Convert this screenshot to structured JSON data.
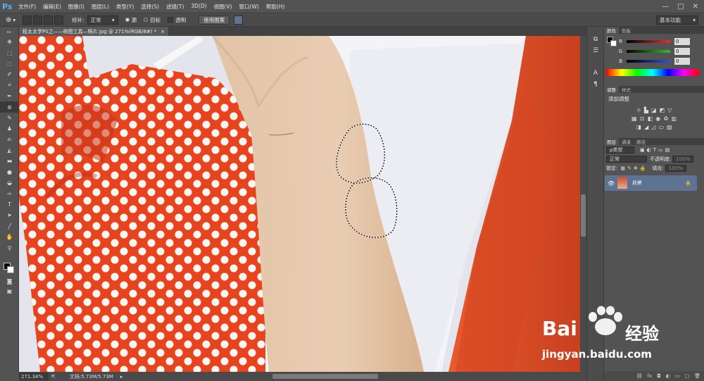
{
  "app": {
    "logo": "Ps"
  },
  "menu": [
    "文件(F)",
    "编辑(E)",
    "图像(I)",
    "图层(L)",
    "类型(Y)",
    "选择(S)",
    "滤镜(T)",
    "3D(D)",
    "视图(V)",
    "窗口(W)",
    "帮助(H)"
  ],
  "window_controls": [
    "—",
    "□",
    "✕"
  ],
  "options": {
    "mode_label": "修补:",
    "mode_value": "正常",
    "source_label": "源",
    "dest_label": "目标",
    "transparent_label": "透明",
    "use_pattern_label": "使用图案",
    "workspace": "基本功能"
  },
  "document": {
    "tab_title": "程太太学PS之——修图工具—照片.jpg @ 271%(RGB/8#) *",
    "close": "×"
  },
  "status": {
    "zoom": "271.34%",
    "doc_info": "文档:5.73M/5.73M"
  },
  "tools": [
    "move-tool",
    "marquee-tool",
    "lasso-tool",
    "quick-select-tool",
    "crop-tool",
    "eyedropper-tool",
    "patch-tool",
    "brush-tool",
    "stamp-tool",
    "history-brush-tool",
    "eraser-tool",
    "gradient-tool",
    "blur-tool",
    "dodge-tool",
    "pen-tool",
    "type-tool",
    "path-select-tool",
    "shape-tool",
    "hand-tool",
    "zoom-tool"
  ],
  "color_panel": {
    "tabs": [
      "颜色",
      "色板"
    ],
    "channels": [
      {
        "label": "R",
        "value": "0",
        "color": "#e53030"
      },
      {
        "label": "G",
        "value": "0",
        "color": "#30c030"
      },
      {
        "label": "B",
        "value": "0",
        "color": "#3050e0"
      }
    ]
  },
  "adjust_panel": {
    "tabs": [
      "调整",
      "样式"
    ],
    "title": "添加调整"
  },
  "layers_panel": {
    "tabs": [
      "图层",
      "通道",
      "路径"
    ],
    "filter_label": "ρ类型",
    "blend_mode": "正常",
    "opacity_label": "不透明度:",
    "opacity_value": "100%",
    "lock_label": "锁定:",
    "fill_label": "填充:",
    "fill_value": "100%",
    "layer_name": "背景"
  },
  "watermark": {
    "brand_left": "Bai",
    "brand_right": "经验",
    "url": "jingyan.baidu.com"
  }
}
